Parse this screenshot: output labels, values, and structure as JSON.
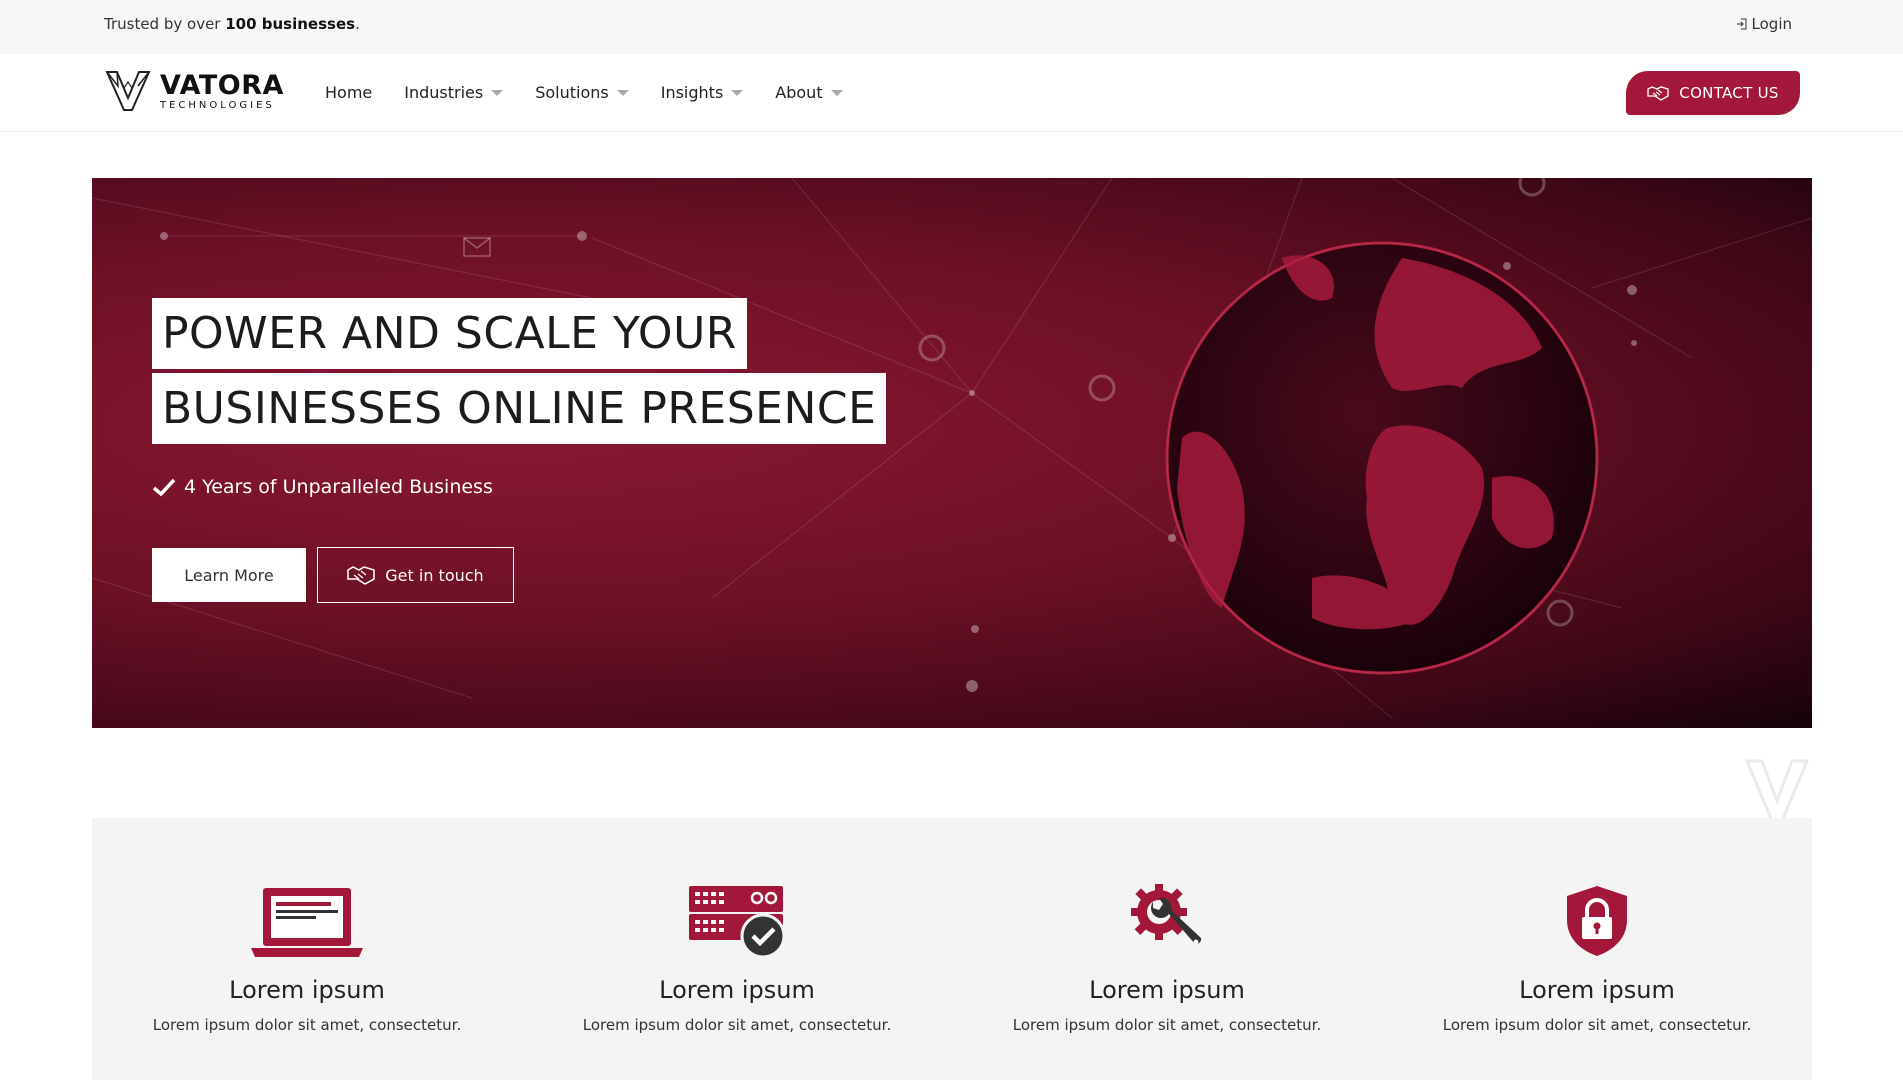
{
  "topbar": {
    "trust_prefix": "Trusted by over ",
    "trust_bold": "100 businesses",
    "trust_suffix": ".",
    "login_label": "Login"
  },
  "header": {
    "brand_name": "VATORA",
    "brand_sub": "TECHNOLOGIES",
    "nav": [
      {
        "label": "Home",
        "dropdown": false
      },
      {
        "label": "Industries",
        "dropdown": true
      },
      {
        "label": "Solutions",
        "dropdown": true
      },
      {
        "label": "Insights",
        "dropdown": true
      },
      {
        "label": "About",
        "dropdown": true
      }
    ],
    "contact_label": "CONTACT US"
  },
  "hero": {
    "title_line1": "POWER AND SCALE YOUR",
    "title_line2": "BUSINESSES ONLINE PRESENCE",
    "checkpoint": "4 Years of Unparalleled Business",
    "learn_more": "Learn More",
    "get_in_touch": "Get in touch"
  },
  "features": [
    {
      "icon": "laptop-icon",
      "title": "Lorem ipsum",
      "desc": "Lorem ipsum dolor sit amet, consectetur."
    },
    {
      "icon": "server-check-icon",
      "title": "Lorem ipsum",
      "desc": "Lorem ipsum dolor sit amet, consectetur."
    },
    {
      "icon": "gear-wrench-icon",
      "title": "Lorem ipsum",
      "desc": "Lorem ipsum dolor sit amet, consectetur."
    },
    {
      "icon": "shield-lock-icon",
      "title": "Lorem ipsum",
      "desc": "Lorem ipsum dolor sit amet, consectetur."
    }
  ],
  "colors": {
    "accent": "#a3183a",
    "hero_dark": "#14020a",
    "feature_bg": "#f4f4f4",
    "topbar_bg": "#f6f6f6"
  }
}
